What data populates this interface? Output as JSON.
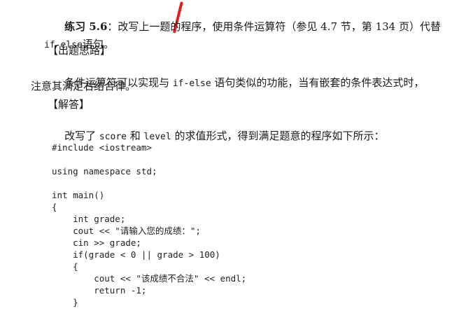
{
  "exercise": {
    "label": "练习 5.6",
    "text_after_label": "：改写上一题的程序，使用条件运算符（参见 4.7 节，第 134 页）代替",
    "code_term": "if-else",
    "line2_tail": "语句。"
  },
  "section_idea": {
    "heading": "【出题思路】",
    "line1_pre": "条件运算符可以实现与 ",
    "line1_code": "if-else",
    "line1_post": " 语句类似的功能，当有嵌套的条件表达式时，",
    "line2": "注意其满足右结合律。"
  },
  "section_answer": {
    "heading": "【解答】",
    "line1_pre": "改写了 ",
    "code_a": "score",
    "mid": " 和 ",
    "code_b": "level",
    "line1_post": " 的求值形式，得到满足题意的程序如下所示："
  },
  "code_lines": [
    "#include <iostream>",
    "",
    "using namespace std;",
    "",
    "int main()",
    "{",
    "    int grade;",
    "    cout << \"请输入您的成绩：\";",
    "    cin >> grade;",
    "    if(grade < 0 || grade > 100)",
    "    {",
    "        cout << \"该成绩不合法\" << endl;",
    "        return -1;",
    "    }"
  ]
}
